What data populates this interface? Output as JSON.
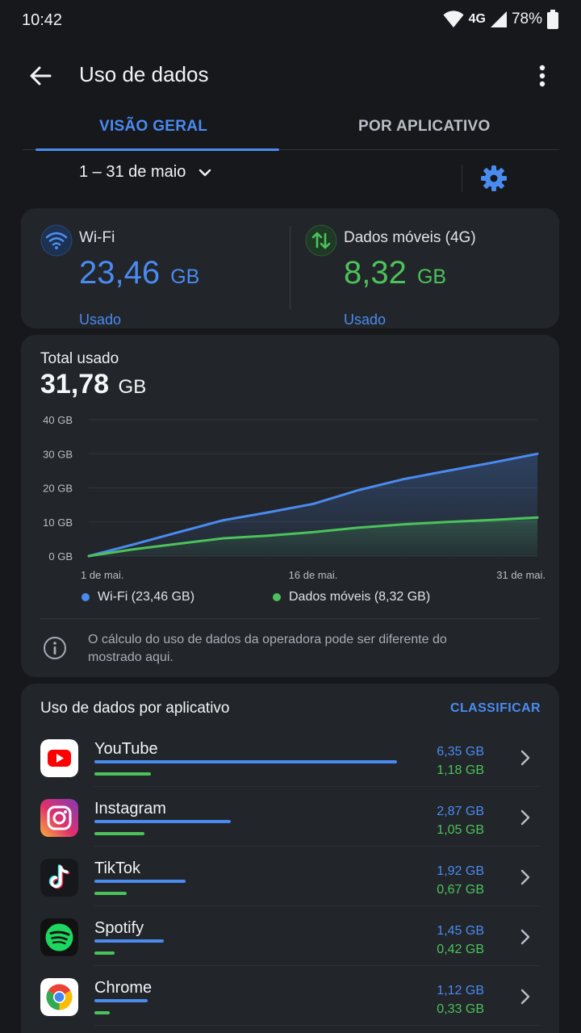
{
  "status": {
    "time": "10:42",
    "network": "4G",
    "battery": "78%"
  },
  "appbar": {
    "title": "Uso de dados"
  },
  "tabs": [
    {
      "label": "VISÃO GERAL"
    },
    {
      "label": "POR APLICATIVO"
    }
  ],
  "period": {
    "label": "1 – 31 de maio"
  },
  "usage": {
    "wifi": {
      "label": "Wi-Fi",
      "value": "23,46",
      "unit": "GB",
      "sub": "Usado"
    },
    "mobile": {
      "label": "Dados móveis (4G)",
      "value": "8,32",
      "unit": "GB",
      "sub": "Usado"
    }
  },
  "total": {
    "label": "Total usado",
    "value": "31,78",
    "unit": "GB"
  },
  "legend": {
    "wifi": "Wi-Fi (23,46 GB)",
    "mobile": "Dados móveis (8,32 GB)"
  },
  "info": {
    "text": "O cálculo do uso de dados da operadora pode ser diferente do mostrado aqui."
  },
  "colors": {
    "wifi": "#4a8bf0",
    "mobile": "#4cc25a",
    "background": "#16181c",
    "card": "#22252a"
  },
  "chart_data": {
    "type": "area",
    "y_ticks": [
      "40 GB",
      "30 GB",
      "20 GB",
      "10 GB",
      "0 GB"
    ],
    "x_ticks": [
      "1 de mai.",
      "16 de mai.",
      "31 de mai."
    ],
    "ylim": [
      0,
      40
    ],
    "x": [
      1,
      4,
      7,
      10,
      13,
      16,
      19,
      22,
      25,
      28,
      31
    ],
    "series": [
      {
        "name": "Wi-Fi (23,46 GB)",
        "values": [
          0,
          3.4,
          7,
          10.5,
          12.8,
          15.3,
          19.3,
          22.5,
          25,
          27.4,
          30
        ]
      },
      {
        "name": "Dados móveis (8,32 GB)",
        "values": [
          0,
          2,
          3.6,
          5.2,
          6,
          7,
          8.3,
          9.3,
          10,
          10.6,
          11.3
        ]
      }
    ],
    "grid": true,
    "legend": "bottom"
  },
  "apps_section": {
    "title": "Uso de dados por aplicativo",
    "sort_label": "CLASSIFICAR"
  },
  "apps": [
    {
      "name": "YouTube",
      "wifi": "6,35 GB",
      "mobile": "1,18 GB",
      "wifi_gb": 6.35,
      "mobile_gb": 1.18,
      "icon": "youtube-icon"
    },
    {
      "name": "Instagram",
      "wifi": "2,87 GB",
      "mobile": "1,05 GB",
      "wifi_gb": 2.87,
      "mobile_gb": 1.05,
      "icon": "instagram-icon"
    },
    {
      "name": "TikTok",
      "wifi": "1,92 GB",
      "mobile": "0,67 GB",
      "wifi_gb": 1.92,
      "mobile_gb": 0.67,
      "icon": "tiktok-icon"
    },
    {
      "name": "Spotify",
      "wifi": "1,45 GB",
      "mobile": "0,42 GB",
      "wifi_gb": 1.45,
      "mobile_gb": 0.42,
      "icon": "spotify-icon"
    },
    {
      "name": "Chrome",
      "wifi": "1,12 GB",
      "mobile": "0,33 GB",
      "wifi_gb": 1.12,
      "mobile_gb": 0.33,
      "icon": "chrome-icon"
    }
  ]
}
